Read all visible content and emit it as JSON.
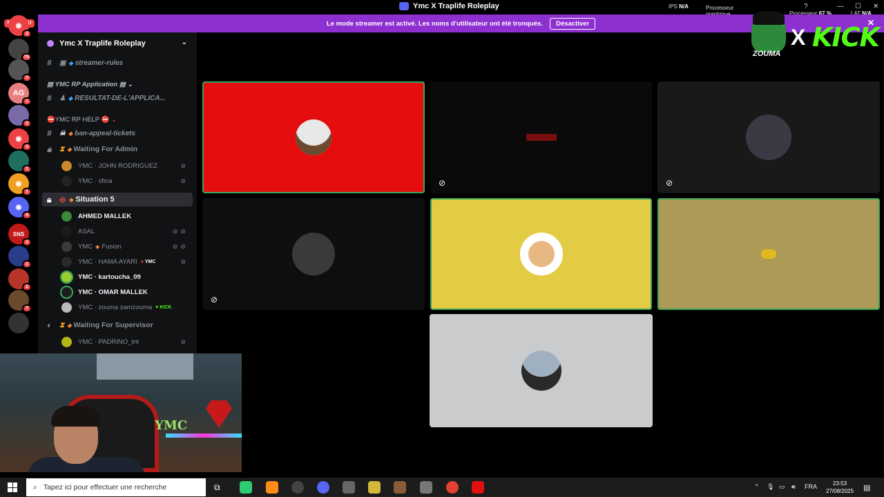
{
  "window": {
    "title": "Ymc X Traplife Roleplay",
    "ips_label": "IPS",
    "ips_value": "N/A",
    "gpu_label_1": "Processeur",
    "gpu_label_2": "graphique",
    "cpu_label": "Processeur",
    "cpu_value": "67 %",
    "lat_label": "LAT",
    "lat_value": "N/A"
  },
  "banner": {
    "message": "Le mode streamer est activé. Les noms d'utilisateur ont été tronqués.",
    "button": "Désactiver"
  },
  "rail": {
    "new_badge": "NOUVEAU",
    "servers": [
      {
        "icon": "discord-icon",
        "badge": "2",
        "color": "#ed4245"
      },
      {
        "icon": "server-icon",
        "badge": "75",
        "color": "#444"
      },
      {
        "icon": "server-icon",
        "badge": "3",
        "color": "#555"
      },
      {
        "icon": "server-icon",
        "text": "AG",
        "badge": "1",
        "color": "#e88080"
      },
      {
        "icon": "server-icon",
        "badge": "2",
        "color": "#7a6aa8"
      },
      {
        "icon": "discord-icon",
        "badge": "3",
        "color": "#ed4245"
      },
      {
        "icon": "server-icon",
        "badge": "1",
        "color": "#1f6f60"
      },
      {
        "icon": "discord-icon",
        "badge": "1",
        "color": "#f0a020"
      },
      {
        "icon": "discord-icon",
        "badge": "4",
        "color": "#5865f2"
      },
      {
        "icon": "server-icon",
        "text": "SNS",
        "badge": "2",
        "color": "#c41a1a"
      },
      {
        "icon": "server-icon",
        "badge": "2",
        "color": "#2a3d8a"
      },
      {
        "icon": "server-icon",
        "badge": "2",
        "color": "#b7342a"
      },
      {
        "icon": "server-icon",
        "badge": "7",
        "color": "#6a4a2a"
      },
      {
        "icon": "server-icon",
        "color": "#333"
      }
    ]
  },
  "sidebar": {
    "server_name": "Ymc X Traplife Roleplay",
    "rows": {
      "streamer_rules": "streamer-rules",
      "cat_application": "YMC RP Application",
      "resultat": "RESULTAT-DE-L'APPLICA...",
      "cat_help": "YMC RP HELP",
      "ban_appeal": "ban-appeal-tickets",
      "waiting_admin": "Waiting For Admin",
      "user_john": "YMC · JOHN RODRIGUEZ",
      "user_sfina": "YMC · sfina",
      "situation": "Situation 5",
      "user_ahmed": "AHMED MALLEK",
      "user_asal": "ASAL",
      "user_fusion_prefix": "YMC",
      "user_fusion": "Fusion",
      "user_hama": "YMC · HAMA AYARI",
      "user_hama_tag": "YMC",
      "user_kartoucha": "YMC · kartoucha_09",
      "user_omar": "YMC · OMAR MALLEK",
      "user_zouma": "YMC · zouma zamzouma",
      "user_zouma_tag": "KICK",
      "waiting_supervisor": "Waiting For Supervisor",
      "user_padrino": "YMC · PADRINO_tnt"
    }
  },
  "overlay": {
    "x": "X",
    "kick": "KICK",
    "zouma": "ZOUMA"
  },
  "webcam": {
    "wall_text": "YMC"
  },
  "video_tiles": [
    {
      "name": "tile-1",
      "bg": "#e50d0d",
      "speaking": true,
      "muted": false
    },
    {
      "name": "tile-2",
      "bg": "#0a0a0a",
      "speaking": false,
      "muted": true
    },
    {
      "name": "tile-3",
      "bg": "#191919",
      "speaking": false,
      "muted": true
    },
    {
      "name": "tile-4",
      "bg": "#0e0e0e",
      "speaking": false,
      "muted": true
    },
    {
      "name": "tile-5",
      "bg": "#e3cc43",
      "speaking": true,
      "muted": false
    },
    {
      "name": "tile-6",
      "bg": "#ad9a56",
      "speaking": true,
      "muted": false
    },
    {
      "name": "tile-7",
      "bg": "#c9cbcd",
      "speaking": false,
      "muted": false
    }
  ],
  "taskbar": {
    "search_placeholder": "Tapez ici pour effectuer une recherche",
    "language": "FRA",
    "time": "23:53",
    "date": "27/08/2025"
  }
}
